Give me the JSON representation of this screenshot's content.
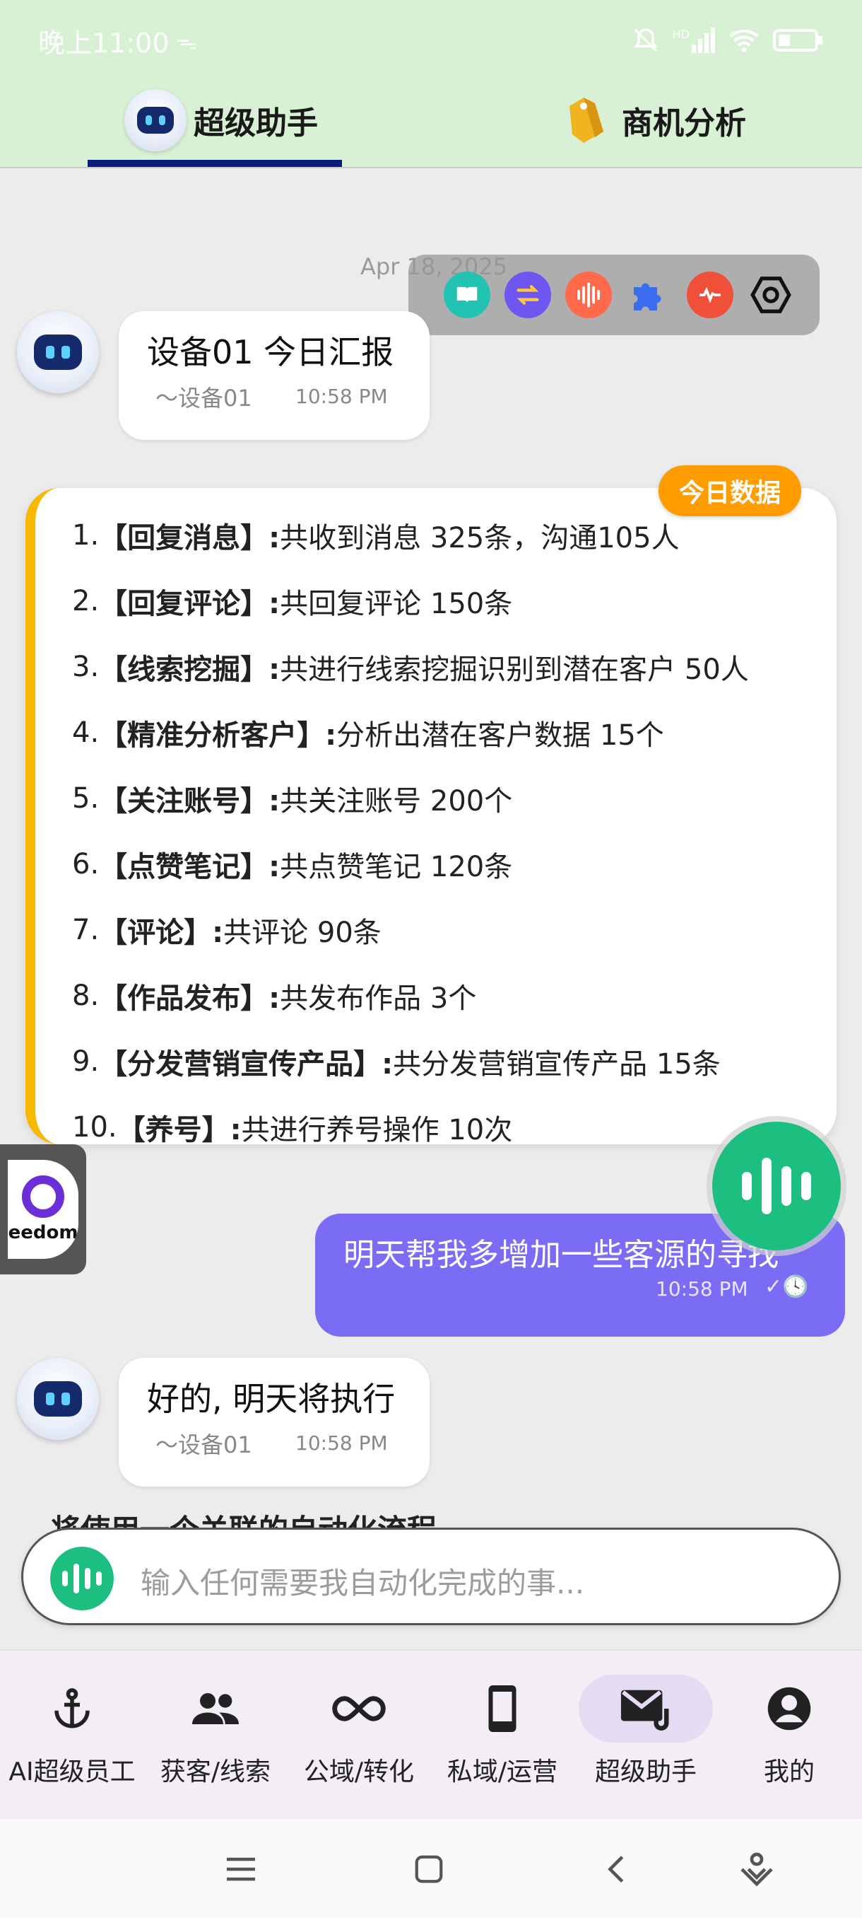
{
  "status": {
    "time": "晚上11:00",
    "network_label": "HD"
  },
  "tabs": [
    {
      "label": "超级助手",
      "active": true
    },
    {
      "label": "商机分析",
      "active": false
    }
  ],
  "chat": {
    "date": "Apr 18, 2025",
    "messages": [
      {
        "text": "设备01 今日汇报",
        "sender": "～设备01",
        "time": "10:58 PM"
      },
      {
        "text": "明天帮我多增加一些客源的寻找",
        "time": "10:58 PM"
      },
      {
        "text": "好的, 明天将执行",
        "sender": "～设备01",
        "time": "10:58 PM"
      }
    ],
    "partial_text": "将使用一个关联的自动化流程"
  },
  "report": {
    "badge": "今日数据",
    "items": [
      {
        "num": "1.",
        "title": "【回复消息】:",
        "desc": "共收到消息 325条，沟通105人"
      },
      {
        "num": "2.",
        "title": "【回复评论】:",
        "desc": "共回复评论 150条"
      },
      {
        "num": "3.",
        "title": "【线索挖掘】:",
        "desc": "共进行线索挖掘识别到潜在客户 50人"
      },
      {
        "num": "4.",
        "title": "【精准分析客户】:",
        "desc": "分析出潜在客户数据 15个"
      },
      {
        "num": "5.",
        "title": "【关注账号】:",
        "desc": "共关注账号 200个"
      },
      {
        "num": "6.",
        "title": "【点赞笔记】:",
        "desc": "共点赞笔记 120条"
      },
      {
        "num": "7.",
        "title": "【评论】:",
        "desc": "共评论 90条"
      },
      {
        "num": "8.",
        "title": "【作品发布】:",
        "desc": "共发布作品 3个"
      },
      {
        "num": "9.",
        "title": "【分发营销宣传产品】:",
        "desc": "共分发营销宣传产品 15条"
      },
      {
        "num": "10.",
        "title": "【养号】:",
        "desc": "共进行养号操作 10次"
      }
    ]
  },
  "floating_app": {
    "label": "eedom"
  },
  "input": {
    "placeholder": "输入任何需要我自动化完成的事..."
  },
  "bottom_nav": [
    {
      "label": "AI超级员工",
      "icon": "anchor-icon"
    },
    {
      "label": "获客/线索",
      "icon": "people-icon"
    },
    {
      "label": "公域/转化",
      "icon": "infinity-icon"
    },
    {
      "label": "私域/运营",
      "icon": "phone-icon"
    },
    {
      "label": "超级助手",
      "icon": "mail-attach-icon",
      "active": true
    },
    {
      "label": "我的",
      "icon": "account-icon"
    }
  ],
  "colors": {
    "header_bg": "#d8f0d4",
    "accent_yellow": "#f6b900",
    "badge_orange": "#ff9d00",
    "sent_bubble": "#7a6cf5",
    "voice_green": "#1dbf80"
  }
}
